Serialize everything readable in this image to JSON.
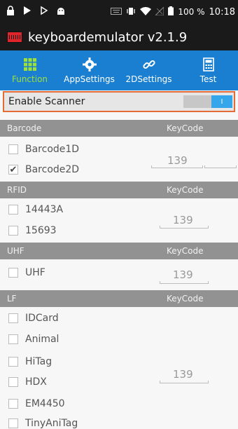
{
  "statusbar": {
    "battery_percent": "100 %",
    "time": "10:18"
  },
  "appbar": {
    "title": "keyboardemulator v2.1.9"
  },
  "tabs": [
    {
      "label": "Function",
      "active": true
    },
    {
      "label": "AppSettings"
    },
    {
      "label": "2DSettings"
    },
    {
      "label": "Test"
    }
  ],
  "enable": {
    "label": "Enable Scanner",
    "toggle_text": "I"
  },
  "barcode": {
    "header": "Barcode",
    "keycode_label": "KeyCode",
    "items": [
      {
        "label": "Barcode1D",
        "checked": false
      },
      {
        "label": "Barcode2D",
        "checked": true
      }
    ],
    "value": "139",
    "checkmark": "✔"
  },
  "rfid": {
    "header": "RFID",
    "keycode_label": "KeyCode",
    "items": [
      {
        "label": "14443A"
      },
      {
        "label": "15693"
      }
    ],
    "value": "139"
  },
  "uhf": {
    "header": "UHF",
    "keycode_label": "KeyCode",
    "items": [
      {
        "label": "UHF"
      }
    ],
    "value": "139"
  },
  "lf": {
    "header": "LF",
    "keycode_label": "KeyCode",
    "items": [
      {
        "label": "IDCard"
      },
      {
        "label": "Animal"
      },
      {
        "label": "HiTag"
      },
      {
        "label": "HDX"
      },
      {
        "label": "EM4450"
      },
      {
        "label": "TinyAniTag"
      }
    ],
    "value": "139"
  }
}
